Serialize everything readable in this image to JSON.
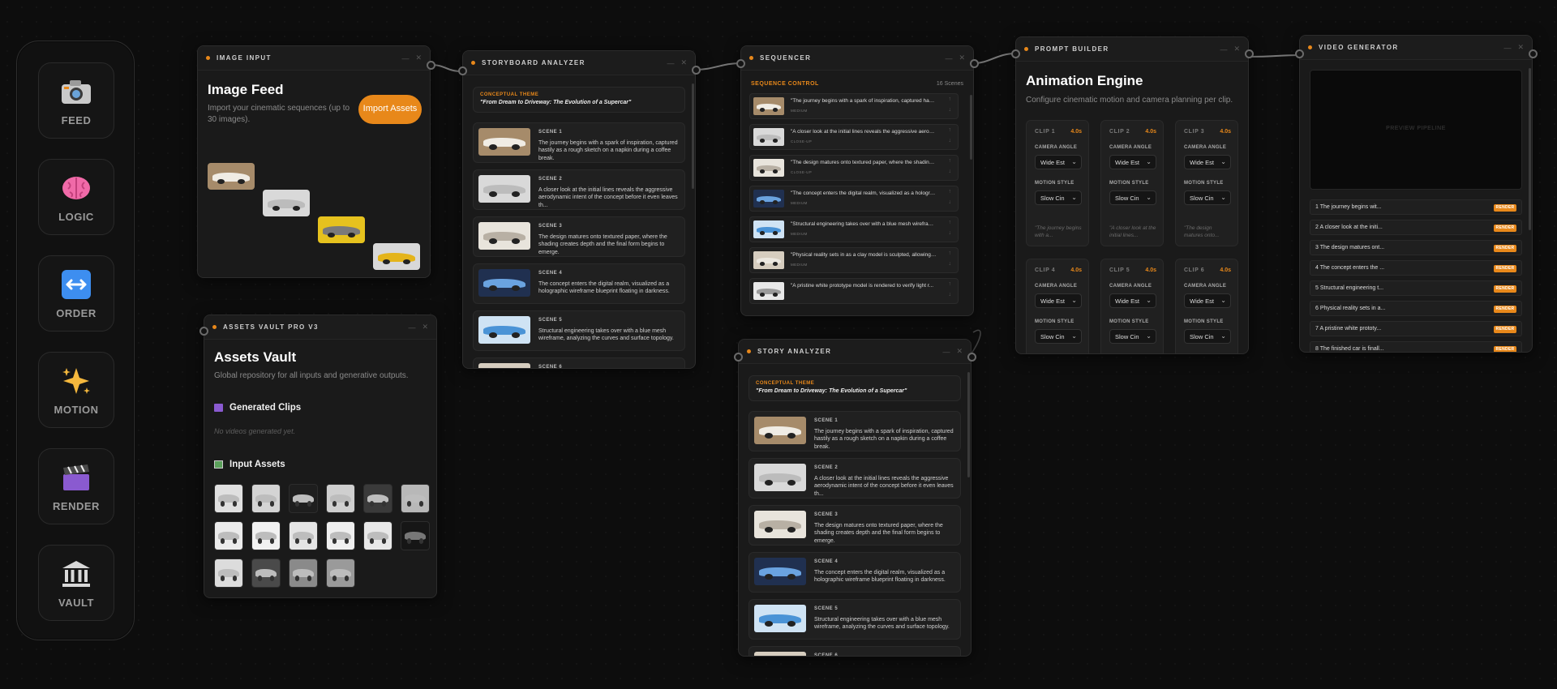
{
  "dock": [
    {
      "label": "FEED",
      "icon": "camera-icon"
    },
    {
      "label": "LOGIC",
      "icon": "brain-icon"
    },
    {
      "label": "ORDER",
      "icon": "arrows-icon"
    },
    {
      "label": "MOTION",
      "icon": "sparkles-icon"
    },
    {
      "label": "RENDER",
      "icon": "clapper-icon"
    },
    {
      "label": "VAULT",
      "icon": "bank-icon"
    }
  ],
  "colors": {
    "accent": "#e8881a",
    "panel": "#1a1a1a",
    "background": "#0d0d0d"
  },
  "image_input": {
    "header": "IMAGE INPUT",
    "title": "Image Feed",
    "subtitle": "Import your cinematic sequences (up to 30 images).",
    "button": "Import Assets"
  },
  "storyboard": {
    "header": "STORYBOARD ANALYZER",
    "theme_label": "CONCEPTUAL THEME",
    "theme": "\"From Dream to Driveway: The Evolution of a Supercar\"",
    "scenes": [
      {
        "label": "SCENE 1",
        "text": "The journey begins with a spark of inspiration, captured hastily as a rough sketch on a napkin during a coffee break."
      },
      {
        "label": "SCENE 2",
        "text": "A closer look at the initial lines reveals the aggressive aerodynamic intent of the concept before it even leaves th..."
      },
      {
        "label": "SCENE 3",
        "text": "The design matures onto textured paper, where the shading creates depth and the final form begins to emerge."
      },
      {
        "label": "SCENE 4",
        "text": "The concept enters the digital realm, visualized as a holographic wireframe blueprint floating in darkness."
      },
      {
        "label": "SCENE 5",
        "text": "Structural engineering takes over with a blue mesh wireframe, analyzing the curves and surface topology."
      },
      {
        "label": "SCENE 6",
        "text": ""
      }
    ]
  },
  "sequencer": {
    "header": "SEQUENCER",
    "control_label": "SEQUENCE CONTROL",
    "count": "16 Scenes",
    "rows": [
      {
        "text": "\"The journey begins with a spark of inspiration, captured hast...",
        "meta": "MEDIUM"
      },
      {
        "text": "\"A closer look at the initial lines reveals the aggressive aerody...",
        "meta": "CLOSE-UP"
      },
      {
        "text": "\"The design matures onto textured paper, where the shading ...",
        "meta": "CLOSE-UP"
      },
      {
        "text": "\"The concept enters the digital realm, visualized as a hologra...",
        "meta": "MEDIUM"
      },
      {
        "text": "\"Structural engineering takes over with a blue mesh wirefram...",
        "meta": "MEDIUM"
      },
      {
        "text": "\"Physical reality sets in as a clay model is sculpted, allowing d...",
        "meta": "MEDIUM"
      },
      {
        "text": "\"A pristine white prototype model is rendered to verify light r...",
        "meta": ""
      }
    ]
  },
  "prompt_builder": {
    "header": "PROMPT BUILDER",
    "title": "Animation Engine",
    "subtitle": "Configure cinematic motion and camera planning per clip.",
    "camera_label": "CAMERA ANGLE",
    "motion_label": "MOTION STYLE",
    "clips": [
      {
        "name": "CLIP 1",
        "dur": "4.0s",
        "camera": "Wide Est",
        "motion": "Slow Cin",
        "note": "\"The journey begins with a..."
      },
      {
        "name": "CLIP 2",
        "dur": "4.0s",
        "camera": "Wide Est",
        "motion": "Slow Cin",
        "note": "\"A closer look at the initial lines..."
      },
      {
        "name": "CLIP 3",
        "dur": "4.0s",
        "camera": "Wide Est",
        "motion": "Slow Cin",
        "note": "\"The design matures onto..."
      },
      {
        "name": "CLIP 4",
        "dur": "4.0s",
        "camera": "Wide Est",
        "motion": "Slow Cin",
        "note": ""
      },
      {
        "name": "CLIP 5",
        "dur": "4.0s",
        "camera": "Wide Est",
        "motion": "Slow Cin",
        "note": ""
      },
      {
        "name": "CLIP 6",
        "dur": "4.0s",
        "camera": "Wide Est",
        "motion": "Slow Cin",
        "note": ""
      }
    ]
  },
  "video_generator": {
    "header": "VIDEO GENERATOR",
    "preview": "PREVIEW PIPELINE",
    "render_label": "RENDER",
    "rows": [
      "1  The journey begins wit...",
      "2  A closer look at the initi...",
      "3  The design matures ont...",
      "4  The concept enters the ...",
      "5  Structural engineering t...",
      "6  Physical reality sets in a...",
      "7  A pristine white prototy...",
      "8  The finished car is finall..."
    ]
  },
  "vault": {
    "header": "ASSETS VAULT PRO V3",
    "title": "Assets Vault",
    "subtitle": "Global repository for all inputs and generative outputs.",
    "clips_heading": "Generated Clips",
    "clips_empty": "No videos generated yet.",
    "inputs_heading": "Input Assets"
  },
  "story_analyzer": {
    "header": "STORY ANALYZER",
    "theme_label": "CONCEPTUAL THEME",
    "theme": "\"From Dream to Driveway: The Evolution of a Supercar\"",
    "scenes": [
      {
        "label": "SCENE 1",
        "text": "The journey begins with a spark of inspiration, captured hastily as a rough sketch on a napkin during a coffee break."
      },
      {
        "label": "SCENE 2",
        "text": "A closer look at the initial lines reveals the aggressive aerodynamic intent of the concept before it even leaves th..."
      },
      {
        "label": "SCENE 3",
        "text": "The design matures onto textured paper, where the shading creates depth and the final form begins to emerge."
      },
      {
        "label": "SCENE 4",
        "text": "The concept enters the digital realm, visualized as a holographic wireframe blueprint floating in darkness."
      },
      {
        "label": "SCENE 5",
        "text": "Structural engineering takes over with a blue mesh wireframe, analyzing the curves and surface topology."
      },
      {
        "label": "SCENE 6",
        "text": ""
      }
    ]
  }
}
